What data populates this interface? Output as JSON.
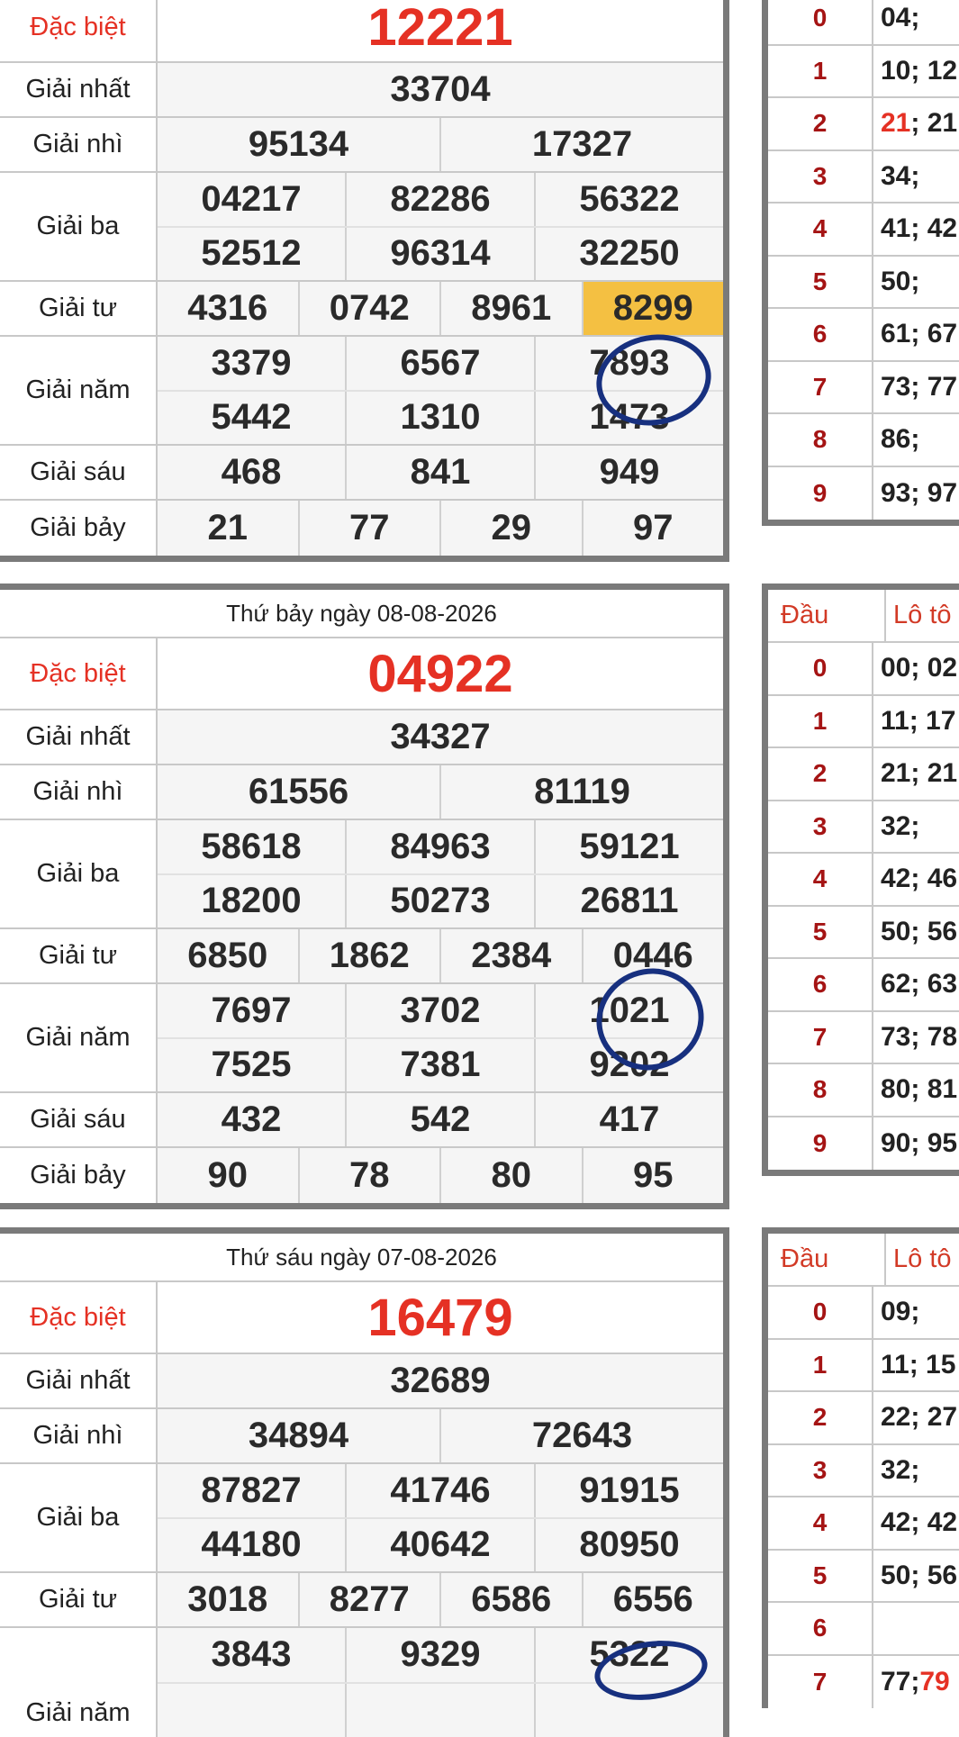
{
  "labels": {
    "db": "Đặc biệt",
    "g1": "Giải nhất",
    "g2": "Giải nhì",
    "g3": "Giải ba",
    "g4": "Giải tư",
    "g5": "Giải năm",
    "g6": "Giải sáu",
    "g7": "Giải bảy",
    "dau": "Đầu",
    "loto": "Lô tô"
  },
  "accent_colors": {
    "special": "#e53124",
    "highlight": "#f4c042",
    "ring": "#17307f",
    "head_digit": "#a51414"
  },
  "draws": [
    {
      "date": "",
      "db": "12221",
      "g1": "33704",
      "g2": [
        "95134",
        "17327"
      ],
      "g3": [
        "04217",
        "82286",
        "56322",
        "52512",
        "96314",
        "32250"
      ],
      "g4": [
        "4316",
        "0742",
        "8961",
        "8299"
      ],
      "g5": [
        "3379",
        "6567",
        "7893",
        "5442",
        "1310",
        "1473"
      ],
      "g6": [
        "468",
        "841",
        "949"
      ],
      "g7": [
        "21",
        "77",
        "29",
        "97"
      ],
      "loto": [
        {
          "d": "0",
          "v": "04;"
        },
        {
          "d": "1",
          "v": "10; 12"
        },
        {
          "d": "2",
          "hi": "21",
          "v": "; 21"
        },
        {
          "d": "3",
          "v": "34;"
        },
        {
          "d": "4",
          "v": "41; 42"
        },
        {
          "d": "5",
          "v": "50;"
        },
        {
          "d": "6",
          "v": "61; 67"
        },
        {
          "d": "7",
          "v": "73; 77"
        },
        {
          "d": "8",
          "v": "86;"
        },
        {
          "d": "9",
          "v": "93; 97"
        }
      ]
    },
    {
      "date": "Thứ bảy ngày 08-08-2026",
      "db": "04922",
      "g1": "34327",
      "g2": [
        "61556",
        "81119"
      ],
      "g3": [
        "58618",
        "84963",
        "59121",
        "18200",
        "50273",
        "26811"
      ],
      "g4": [
        "6850",
        "1862",
        "2384",
        "0446"
      ],
      "g5": [
        "7697",
        "3702",
        "1021",
        "7525",
        "7381",
        "9202"
      ],
      "g6": [
        "432",
        "542",
        "417"
      ],
      "g7": [
        "90",
        "78",
        "80",
        "95"
      ],
      "loto": [
        {
          "d": "0",
          "v": "00; 02"
        },
        {
          "d": "1",
          "v": "11; 17"
        },
        {
          "d": "2",
          "v": "21; 21"
        },
        {
          "d": "3",
          "v": "32;"
        },
        {
          "d": "4",
          "v": "42; 46"
        },
        {
          "d": "5",
          "v": "50; 56"
        },
        {
          "d": "6",
          "v": "62; 63"
        },
        {
          "d": "7",
          "v": "73; 78"
        },
        {
          "d": "8",
          "v": "80; 81"
        },
        {
          "d": "9",
          "v": "90; 95"
        }
      ]
    },
    {
      "date": "Thứ sáu ngày 07-08-2026",
      "db": "16479",
      "g1": "32689",
      "g2": [
        "34894",
        "72643"
      ],
      "g3": [
        "87827",
        "41746",
        "91915",
        "44180",
        "40642",
        "80950"
      ],
      "g4": [
        "3018",
        "8277",
        "6586",
        "6556"
      ],
      "g5": [
        "3843",
        "9329",
        "5322"
      ],
      "loto": [
        {
          "d": "0",
          "v": "09;"
        },
        {
          "d": "1",
          "v": "11; 15"
        },
        {
          "d": "2",
          "v": "22; 27"
        },
        {
          "d": "3",
          "v": "32;"
        },
        {
          "d": "4",
          "v": "42; 42"
        },
        {
          "d": "5",
          "v": "50; 56"
        },
        {
          "d": "6",
          "v": ""
        },
        {
          "d": "7",
          "v": "77; ",
          "hi_after": "79"
        }
      ]
    }
  ]
}
